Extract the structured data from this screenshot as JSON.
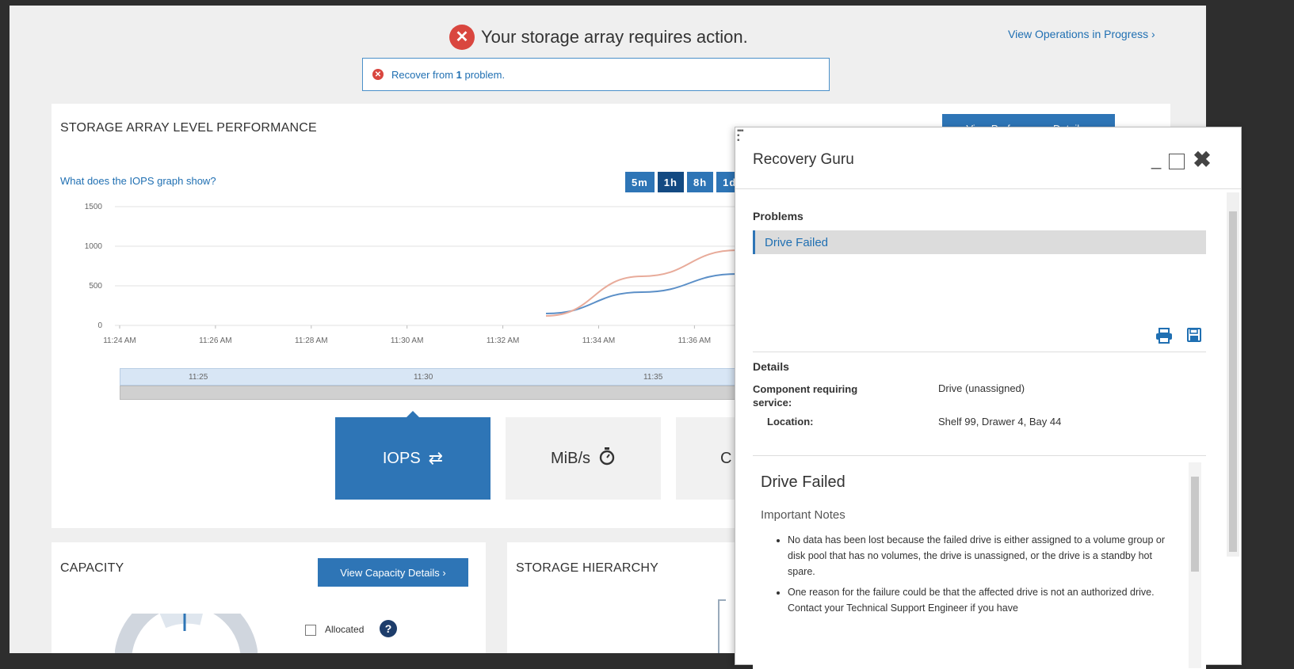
{
  "banner": {
    "message": "Your storage array requires action.",
    "operations_link": "View Operations in Progress ›",
    "recover_prefix": "Recover from ",
    "recover_count": "1",
    "recover_suffix": " problem."
  },
  "performance": {
    "title": "STORAGE ARRAY LEVEL PERFORMANCE",
    "details_button": "View Performance Details ›",
    "help_link": "What does the IOPS graph show?",
    "ranges": [
      "5m",
      "1h",
      "8h",
      "1d"
    ],
    "active_range": "1h",
    "slider_labels": [
      "11:25",
      "11:30",
      "11:35"
    ],
    "tiles": [
      {
        "label": "IOPS",
        "icon": "swap-arrows-icon",
        "active": true
      },
      {
        "label": "MiB/s",
        "icon": "stopwatch-icon",
        "active": false
      },
      {
        "label": "C",
        "icon": "",
        "active": false
      }
    ]
  },
  "chart_data": {
    "type": "line",
    "x": [
      "11:24 AM",
      "11:26 AM",
      "11:28 AM",
      "11:30 AM",
      "11:32 AM",
      "11:34 AM",
      "11:36 AM"
    ],
    "ylim": [
      0,
      1500
    ],
    "yticks": [
      0,
      500,
      1000,
      1500
    ],
    "grid": true,
    "series": [
      {
        "color": "#5b8fc7",
        "points": [
          [
            4.5,
            150
          ],
          [
            5.5,
            420
          ],
          [
            6.5,
            650
          ],
          [
            7.5,
            830
          ],
          [
            8.5,
            960
          ],
          [
            9.5,
            1030
          ],
          [
            10.0,
            1050
          ]
        ]
      },
      {
        "color": "#e8ab9a",
        "points": [
          [
            4.5,
            120
          ],
          [
            5.5,
            620
          ],
          [
            6.5,
            950
          ],
          [
            7.5,
            1050
          ],
          [
            8.5,
            920
          ],
          [
            9.5,
            560
          ],
          [
            10.0,
            360
          ]
        ]
      }
    ]
  },
  "capacity": {
    "title": "CAPACITY",
    "details_button": "View Capacity Details ›",
    "legend_label": "Allocated"
  },
  "hierarchy": {
    "title": "STORAGE HIERARCHY"
  },
  "guru": {
    "title": "Recovery Guru",
    "problems_label": "Problems",
    "problem_item": "Drive Failed",
    "details_label": "Details",
    "component_label": "Component requiring service:",
    "component_value": "Drive (unassigned)",
    "location_label": "Location:",
    "location_value": "Shelf 99, Drawer 4, Bay 44",
    "notes_title": "Drive Failed",
    "notes_subtitle": "Important Notes",
    "notes": [
      "No data has been lost because the failed drive is either assigned to a volume group or disk pool that has no volumes, the drive is unassigned, or the drive is a standby hot spare.",
      "One reason for the failure could be that the affected drive is not an authorized drive. Contact your Technical Support Engineer if you have"
    ]
  }
}
